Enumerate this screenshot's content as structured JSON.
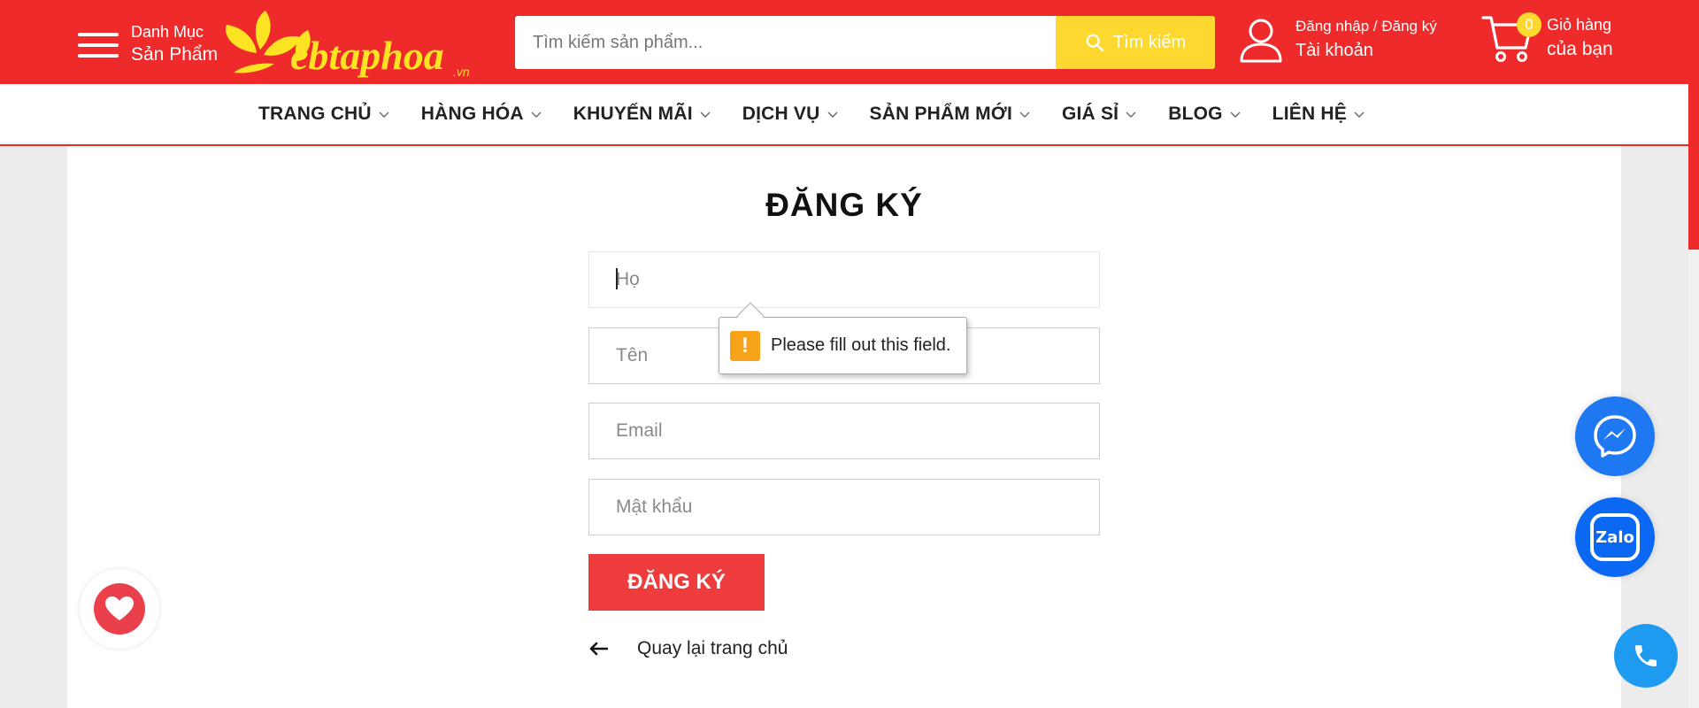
{
  "header": {
    "menu": {
      "line1": "Danh Mục",
      "line2": "Sản Phẩm"
    },
    "logo_text": "ebtaphoa",
    "logo_suffix": ".vn",
    "search": {
      "placeholder": "Tìm kiếm sản phẩm...",
      "button_label": "Tìm kiếm"
    },
    "account": {
      "line1": "Đăng nhập / Đăng ký",
      "line2": "Tài khoản"
    },
    "cart": {
      "count": "0",
      "line1": "Giỏ hàng",
      "line2": "của bạn"
    }
  },
  "nav": {
    "items": [
      {
        "label": "TRANG CHỦ"
      },
      {
        "label": "HÀNG HÓA"
      },
      {
        "label": "KHUYẾN MÃI"
      },
      {
        "label": "DỊCH VỤ"
      },
      {
        "label": "SẢN PHẨM MỚI"
      },
      {
        "label": "GIÁ SỈ"
      },
      {
        "label": "BLOG"
      },
      {
        "label": "LIÊN HỆ"
      }
    ]
  },
  "form": {
    "title": "ĐĂNG KÝ",
    "fields": {
      "last_name": {
        "placeholder": "Họ",
        "value": ""
      },
      "first_name": {
        "placeholder": "Tên",
        "value": ""
      },
      "email": {
        "placeholder": "Email",
        "value": ""
      },
      "password": {
        "placeholder": "Mật khẩu",
        "value": ""
      }
    },
    "submit_label": "ĐĂNG KÝ",
    "back_label": "Quay lại trang chủ"
  },
  "validation": {
    "message": "Please fill out this field.",
    "icon": "!"
  },
  "widgets": {
    "zalo_label": "Zalo"
  },
  "colors": {
    "brand_red": "#ee2a2a",
    "accent_yellow": "#fdd830",
    "submit_red": "#ee3b3b",
    "messenger_blue": "#1d78f2",
    "phone_blue": "#1e9bf0"
  }
}
